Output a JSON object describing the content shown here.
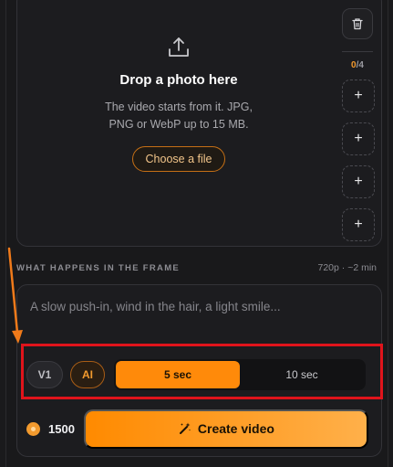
{
  "upload": {
    "title": "Drop a photo here",
    "description": "The video starts from it. JPG, PNG or WebP up to 15 MB.",
    "choose_button": "Choose a file",
    "slot_count_current": "0",
    "slot_count_total": "/4",
    "slot_plus": "+"
  },
  "section": {
    "label": "WHAT HAPPENS IN THE FRAME",
    "meta": "720p · ~2 min"
  },
  "prompt": {
    "placeholder": "A slow push-in, wind in the hair, a light smile..."
  },
  "controls": {
    "version": "V1",
    "ai": "AI",
    "durations": [
      "5 sec",
      "10 sec"
    ]
  },
  "footer": {
    "credits": "1500",
    "create_button": "Create video"
  },
  "colors": {
    "accent": "#ff8a0a",
    "highlight": "#e0141b",
    "arrow": "#f07a1a"
  }
}
